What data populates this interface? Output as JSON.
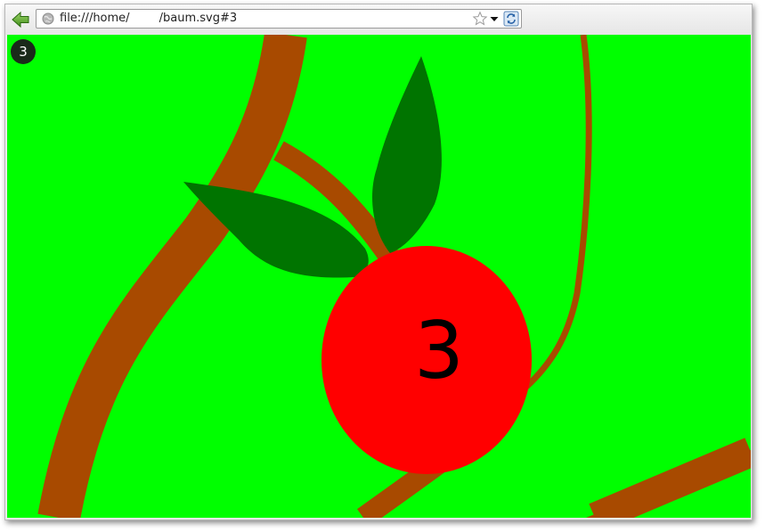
{
  "browser": {
    "url": "file:///home/        /baum.svg#3",
    "icons": {
      "back": "back-arrow-icon",
      "site": "globe-icon",
      "bookmark": "star-icon",
      "history": "dropdown-arrow-icon",
      "reload": "reload-icon"
    }
  },
  "page": {
    "slide_badge": "3",
    "apple_label": "3"
  },
  "colors": {
    "background": "#00ff00",
    "branch": "#a84a00",
    "leaf": "#007400",
    "apple": "#ff0000",
    "badge": "#1a2a1a"
  }
}
